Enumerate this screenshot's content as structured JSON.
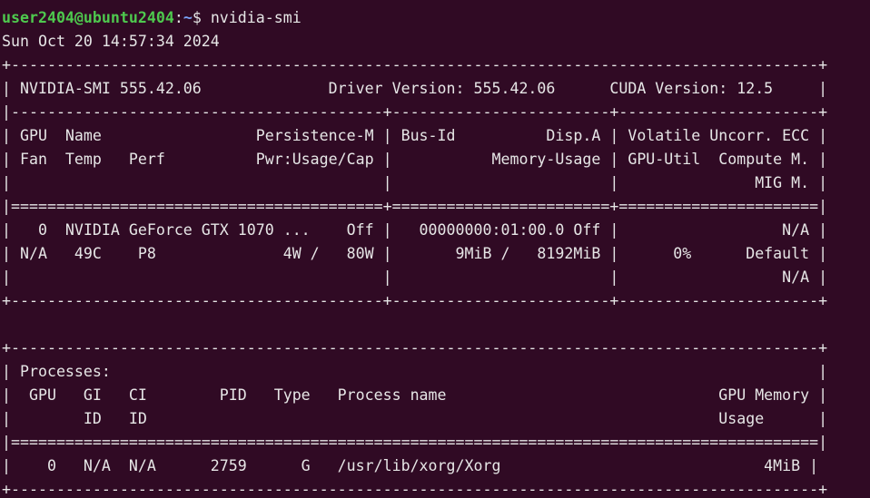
{
  "terminal": {
    "prompt": {
      "user_host": "user2404@ubuntu2404",
      "colon": ":",
      "path": "~",
      "symbol": "$ ",
      "command": "nvidia-smi"
    },
    "lines": [
      "Sun Oct 20 14:57:34 2024",
      "+-----------------------------------------------------------------------------------------+",
      "| NVIDIA-SMI 555.42.06              Driver Version: 555.42.06      CUDA Version: 12.5     |",
      "|-----------------------------------------+------------------------+----------------------+",
      "| GPU  Name                 Persistence-M | Bus-Id          Disp.A | Volatile Uncorr. ECC |",
      "| Fan  Temp   Perf          Pwr:Usage/Cap |           Memory-Usage | GPU-Util  Compute M. |",
      "|                                         |                        |               MIG M. |",
      "|=========================================+========================+======================|",
      "|   0  NVIDIA GeForce GTX 1070 ...    Off |   00000000:01:00.0 Off |                  N/A |",
      "| N/A   49C    P8              4W /   80W |       9MiB /   8192MiB |      0%      Default |",
      "|                                         |                        |                  N/A |",
      "+-----------------------------------------+------------------------+----------------------+",
      "",
      "+-----------------------------------------------------------------------------------------+",
      "| Processes:                                                                              |",
      "|  GPU   GI   CI        PID   Type   Process name                              GPU Memory |",
      "|        ID   ID                                                               Usage      |",
      "|=========================================================================================|",
      "|    0   N/A  N/A      2759      G   /usr/lib/xorg/Xorg                             4MiB |",
      "+-----------------------------------------------------------------------------------------+"
    ]
  }
}
